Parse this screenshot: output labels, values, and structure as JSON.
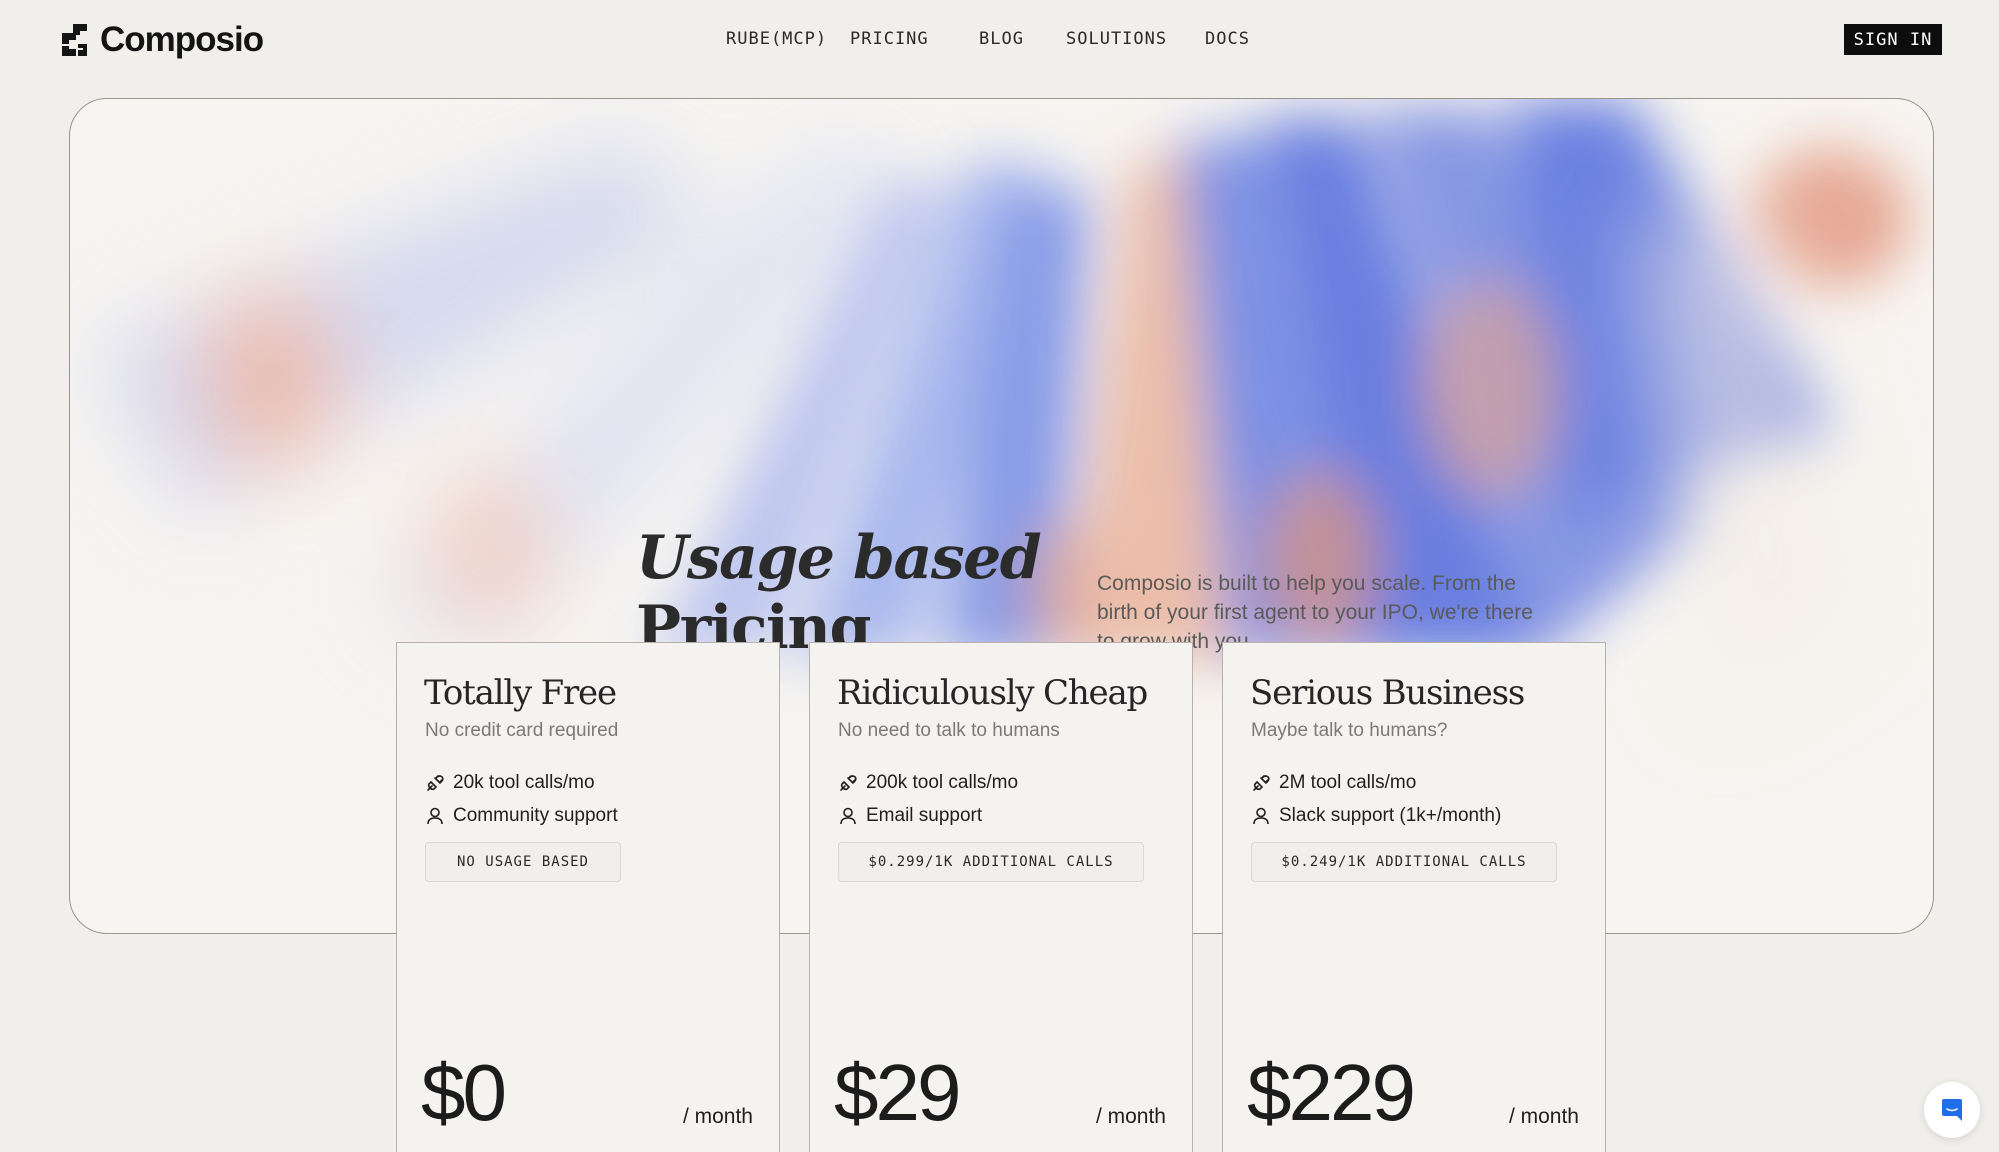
{
  "brand": {
    "name": "Composio"
  },
  "nav": {
    "links": [
      "RUBE(MCP)",
      "PRICING",
      "BLOG",
      "SOLUTIONS",
      "DOCS"
    ],
    "signin_label": "SIGN IN"
  },
  "hero": {
    "title_line1": "Usage based",
    "title_line2": "Pricing",
    "description": "Composio is built to help you scale. From the birth of your first agent to your IPO, we're there to grow with you."
  },
  "plans": [
    {
      "title": "Totally Free",
      "subtitle": "No credit card required",
      "feature_calls": "20k tool calls/mo",
      "feature_support": "Community support",
      "tag": "NO USAGE BASED",
      "price": "$0",
      "period": "/ month"
    },
    {
      "title": "Ridiculously Cheap",
      "subtitle": "No need to talk to humans",
      "feature_calls": "200k tool calls/mo",
      "feature_support": "Email support",
      "tag": "$0.299/1K ADDITIONAL CALLS",
      "price": "$29",
      "period": "/ month"
    },
    {
      "title": "Serious Business",
      "subtitle": "Maybe talk to humans?",
      "feature_calls": "2M tool calls/mo",
      "feature_support": "Slack support (1k+/month)",
      "tag": "$0.249/1K ADDITIONAL CALLS",
      "price": "$229",
      "period": "/ month"
    }
  ],
  "icons": {
    "logo": "composio-logo-icon",
    "calls": "plug-icon",
    "support": "user-icon",
    "chat": "chat-icon"
  },
  "colors": {
    "background": "#f1efec",
    "accent_blue": "#5b74e0",
    "accent_orange": "#e08a6e",
    "button_dark": "#0d0d0d",
    "chat_blue": "#1f6feb"
  }
}
